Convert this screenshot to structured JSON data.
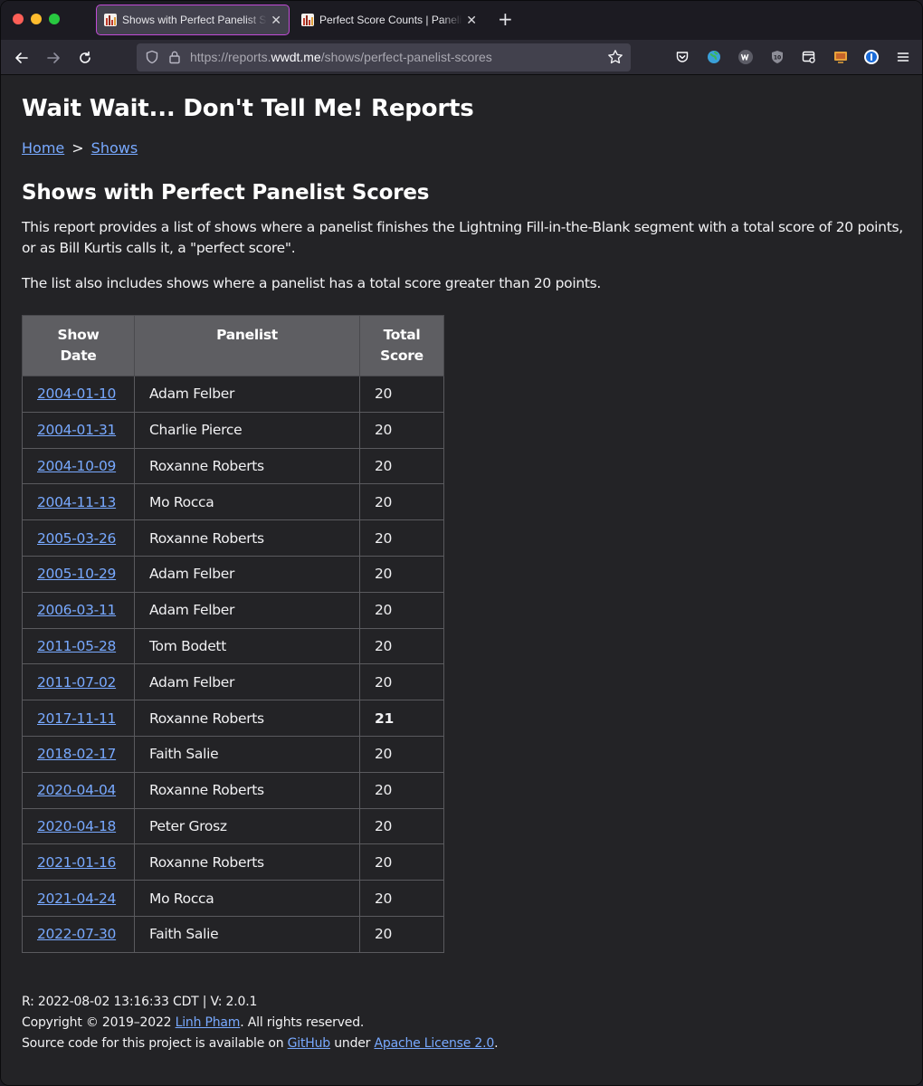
{
  "browser": {
    "tabs": [
      {
        "title": "Shows with Perfect Panelist Scores",
        "active": true
      },
      {
        "title": "Perfect Score Counts | Panelists",
        "active": false
      }
    ],
    "url": {
      "prefix": "https://reports.",
      "domain": "wwdt.me",
      "path": "/shows/perfect-panelist-scores"
    }
  },
  "page": {
    "site_title": "Wait Wait... Don't Tell Me! Reports",
    "breadcrumb": {
      "home": "Home",
      "separator": ">",
      "shows": "Shows"
    },
    "heading": "Shows with Perfect Panelist Scores",
    "description": "This report provides a list of shows where a panelist finishes the Lightning Fill-in-the-Blank segment with a total score of 20 points, or as Bill Kurtis calls it, a \"perfect score\".",
    "description2": "The list also includes shows where a panelist has a total score greater than 20 points."
  },
  "table": {
    "headers": {
      "show_date": "Show Date",
      "panelist": "Panelist",
      "total_score_line1": "Total",
      "total_score_line2": "Score"
    },
    "rows": [
      {
        "date": "2004-01-10",
        "panelist": "Adam Felber",
        "score": "20",
        "highlight": false
      },
      {
        "date": "2004-01-31",
        "panelist": "Charlie Pierce",
        "score": "20",
        "highlight": false
      },
      {
        "date": "2004-10-09",
        "panelist": "Roxanne Roberts",
        "score": "20",
        "highlight": false
      },
      {
        "date": "2004-11-13",
        "panelist": "Mo Rocca",
        "score": "20",
        "highlight": false
      },
      {
        "date": "2005-03-26",
        "panelist": "Roxanne Roberts",
        "score": "20",
        "highlight": false
      },
      {
        "date": "2005-10-29",
        "panelist": "Adam Felber",
        "score": "20",
        "highlight": false
      },
      {
        "date": "2006-03-11",
        "panelist": "Adam Felber",
        "score": "20",
        "highlight": false
      },
      {
        "date": "2011-05-28",
        "panelist": "Tom Bodett",
        "score": "20",
        "highlight": false
      },
      {
        "date": "2011-07-02",
        "panelist": "Adam Felber",
        "score": "20",
        "highlight": false
      },
      {
        "date": "2017-11-11",
        "panelist": "Roxanne Roberts",
        "score": "21",
        "highlight": true
      },
      {
        "date": "2018-02-17",
        "panelist": "Faith Salie",
        "score": "20",
        "highlight": false
      },
      {
        "date": "2020-04-04",
        "panelist": "Roxanne Roberts",
        "score": "20",
        "highlight": false
      },
      {
        "date": "2020-04-18",
        "panelist": "Peter Grosz",
        "score": "20",
        "highlight": false
      },
      {
        "date": "2021-01-16",
        "panelist": "Roxanne Roberts",
        "score": "20",
        "highlight": false
      },
      {
        "date": "2021-04-24",
        "panelist": "Mo Rocca",
        "score": "20",
        "highlight": false
      },
      {
        "date": "2022-07-30",
        "panelist": "Faith Salie",
        "score": "20",
        "highlight": false
      }
    ]
  },
  "footer": {
    "render_info": "R: 2022-08-02 13:16:33 CDT | V: 2.0.1",
    "copyright_prefix": "Copyright © 2019–2022 ",
    "author": "Linh Pham",
    "copyright_suffix": ". All rights reserved.",
    "source_prefix": "Source code for this project is available on ",
    "github": "GitHub",
    "source_middle": " under ",
    "license": "Apache License 2.0",
    "source_suffix": "."
  },
  "colors": {
    "link": "#78a9ff",
    "background": "#232326",
    "table_header": "#5e5e62",
    "active_tab_border": "#c14bd6"
  }
}
